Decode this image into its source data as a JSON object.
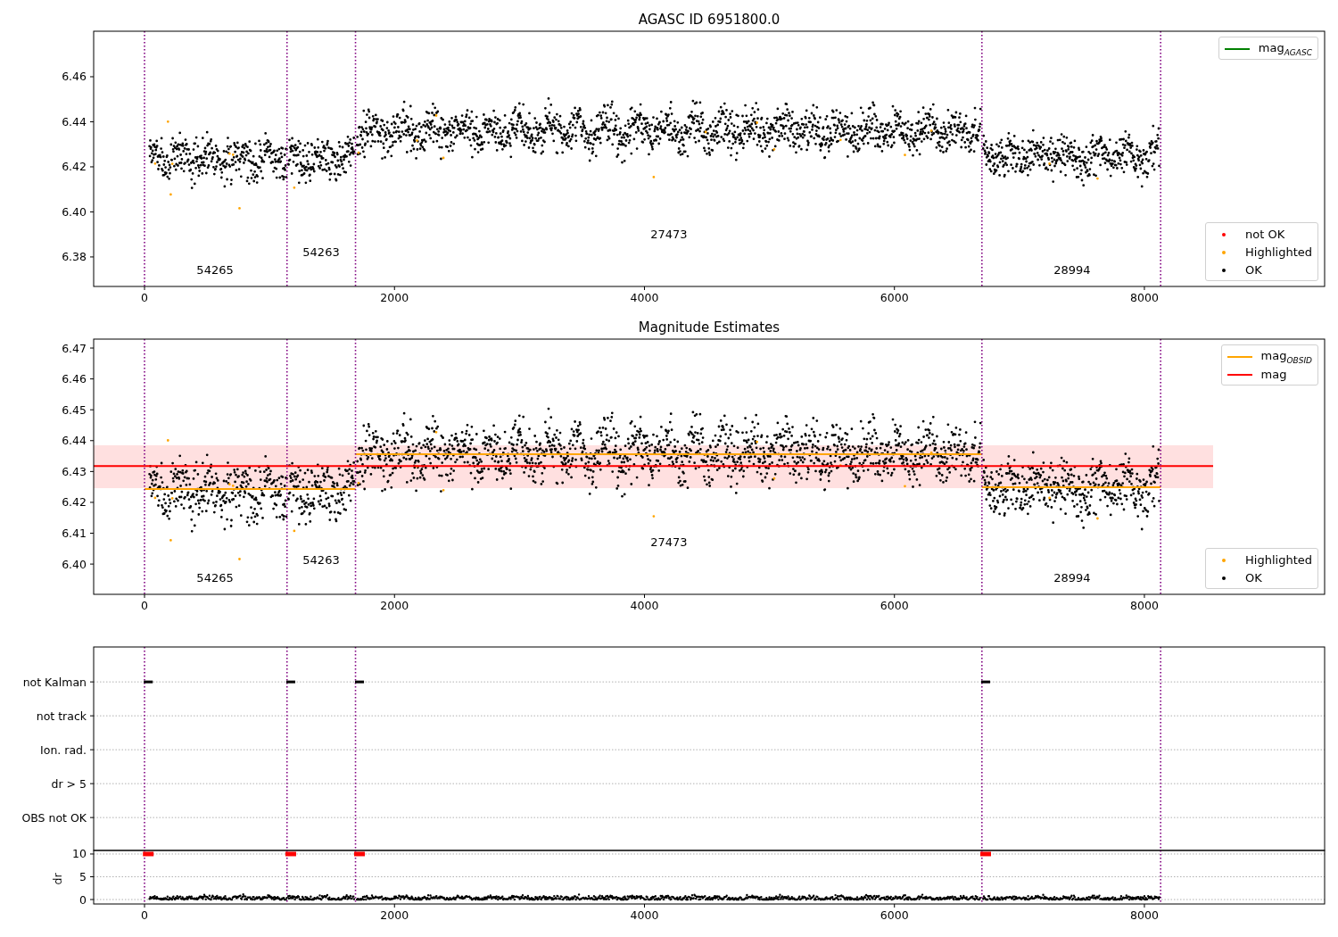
{
  "figure": {
    "panels": [
      {
        "title": "AGASC ID 6951800.0",
        "legends": [
          {
            "items": [
              {
                "label": "mag$_{AGASC}$",
                "kind": "line",
                "color": "#008000"
              }
            ]
          },
          {
            "items": [
              {
                "label": "not OK",
                "kind": "dot",
                "color": "#ff0000"
              },
              {
                "label": "Highlighted",
                "kind": "dot",
                "color": "#ffa500"
              },
              {
                "label": "OK",
                "kind": "dot",
                "color": "#000000"
              }
            ]
          }
        ],
        "chart_data": {
          "type": "scatter",
          "xlim": [
            -407,
            9442
          ],
          "ylim": [
            6.3669,
            6.4802
          ],
          "xticks": [
            0,
            2000,
            4000,
            6000,
            8000
          ],
          "yticks": [
            {
              "value": 6.38,
              "label": "6.38"
            },
            {
              "value": 6.4,
              "label": "6.40"
            },
            {
              "value": 6.42,
              "label": "6.42"
            },
            {
              "value": 6.44,
              "label": "6.44"
            },
            {
              "value": 6.46,
              "label": "6.46"
            }
          ],
          "ref_lines": [
            {
              "axis": "x",
              "value": 0,
              "color": "#800080"
            },
            {
              "axis": "x",
              "value": 1140,
              "color": "#800080"
            },
            {
              "axis": "x",
              "value": 1688,
              "color": "#800080"
            },
            {
              "axis": "x",
              "value": 6700,
              "color": "#800080"
            },
            {
              "axis": "x",
              "value": 8130,
              "color": "#800080"
            }
          ],
          "annotations": [
            "54265",
            "54263",
            "27473",
            "28994"
          ]
        }
      },
      {
        "title": "Magnitude Estimates",
        "legends": [
          {
            "items": [
              {
                "label": "Highlighted",
                "kind": "dot",
                "color": "#ffa500"
              },
              {
                "label": "OK",
                "kind": "dot",
                "color": "#000000"
              }
            ]
          }
        ],
        "chart_data": {
          "type": "line",
          "xlim": [
            -407,
            9442
          ],
          "ylim": [
            6.3902,
            6.4729
          ],
          "xticks": [
            0,
            2000,
            4000,
            6000,
            8000
          ],
          "yticks": [
            {
              "value": 6.4,
              "label": "6.40"
            },
            {
              "value": 6.41,
              "label": "6.41"
            },
            {
              "value": 6.42,
              "label": "6.42"
            },
            {
              "value": 6.43,
              "label": "6.43"
            },
            {
              "value": 6.44,
              "label": "6.44"
            },
            {
              "value": 6.45,
              "label": "6.45"
            },
            {
              "value": 6.46,
              "label": "6.46"
            },
            {
              "value": 6.47,
              "label": "6.47"
            }
          ],
          "ref_lines": [
            {
              "axis": "x",
              "value": 0,
              "color": "#800080"
            },
            {
              "axis": "x",
              "value": 1140,
              "color": "#800080"
            },
            {
              "axis": "x",
              "value": 1688,
              "color": "#800080"
            },
            {
              "axis": "x",
              "value": 6700,
              "color": "#800080"
            },
            {
              "axis": "x",
              "value": 8130,
              "color": "#800080"
            }
          ],
          "bands": [
            {
              "axis": "y",
              "from": 6.4246,
              "to": 6.4385,
              "color": "#ff0000"
            }
          ],
          "series": [
            {
              "name": "mag$_{OBSID}$",
              "color": "#ffa500",
              "x": [
                0,
                1140,
                null,
                1140,
                1688,
                null,
                1688,
                6700,
                null,
                6700,
                8130
              ],
              "values": [
                6.4243,
                6.4243,
                null,
                6.4243,
                6.4243,
                null,
                6.4356,
                6.4356,
                null,
                6.4249,
                6.4249
              ]
            },
            {
              "name": "mag",
              "color": "#ff0000",
              "x": [
                -407,
                8550
              ],
              "values": [
                6.4318,
                6.4318
              ]
            }
          ],
          "annotations": [
            "54265",
            "54263",
            "27473",
            "28994"
          ]
        }
      },
      {
        "flags": {
          "chart_data": {
            "type": "scatter",
            "orientation": "horizontal",
            "grid": true,
            "xlim": [
              -407,
              9442
            ],
            "categories": [
              "not Kalman",
              "not track",
              "Ion. rad.",
              "dr > 5",
              "OBS not OK"
            ],
            "ref_lines": [
              {
                "axis": "x",
                "value": 0,
                "color": "#800080"
              },
              {
                "axis": "x",
                "value": 1140,
                "color": "#800080"
              },
              {
                "axis": "x",
                "value": 1688,
                "color": "#800080"
              },
              {
                "axis": "x",
                "value": 6700,
                "color": "#800080"
              },
              {
                "axis": "x",
                "value": 8130,
                "color": "#800080"
              }
            ],
            "series": [
              {
                "color": "#000000",
                "values": [
                  30,
                  null,
                  null,
                  null,
                  null
                ]
              },
              {
                "color": "#000000",
                "values": [
                  1170,
                  null,
                  null,
                  null,
                  null
                ]
              },
              {
                "color": "#000000",
                "values": [
                  1720,
                  null,
                  null,
                  null,
                  null
                ]
              },
              {
                "color": "#000000",
                "values": [
                  6730,
                  null,
                  null,
                  null,
                  null
                ]
              }
            ]
          }
        },
        "distance": {
          "chart_data": {
            "type": "scatter",
            "grid": true,
            "ylabel": "dr",
            "xlim": [
              -407,
              9442
            ],
            "ylim": [
              -0.98,
              10.78
            ],
            "xticks": [
              0,
              2000,
              4000,
              6000,
              8000
            ],
            "yticks": [
              0,
              5,
              10
            ],
            "ref_lines": [
              {
                "axis": "x",
                "value": 0,
                "color": "#800080"
              },
              {
                "axis": "x",
                "value": 1140,
                "color": "#800080"
              },
              {
                "axis": "x",
                "value": 1688,
                "color": "#800080"
              },
              {
                "axis": "x",
                "value": 6700,
                "color": "#800080"
              },
              {
                "axis": "x",
                "value": 8130,
                "color": "#800080"
              }
            ],
            "series": [
              {
                "color": "#ff0000",
                "x": [
                  30,
                  1170,
                  1720,
                  6730
                ],
                "values": [
                  10,
                  10,
                  10,
                  10
                ]
              }
            ]
          }
        }
      }
    ]
  }
}
